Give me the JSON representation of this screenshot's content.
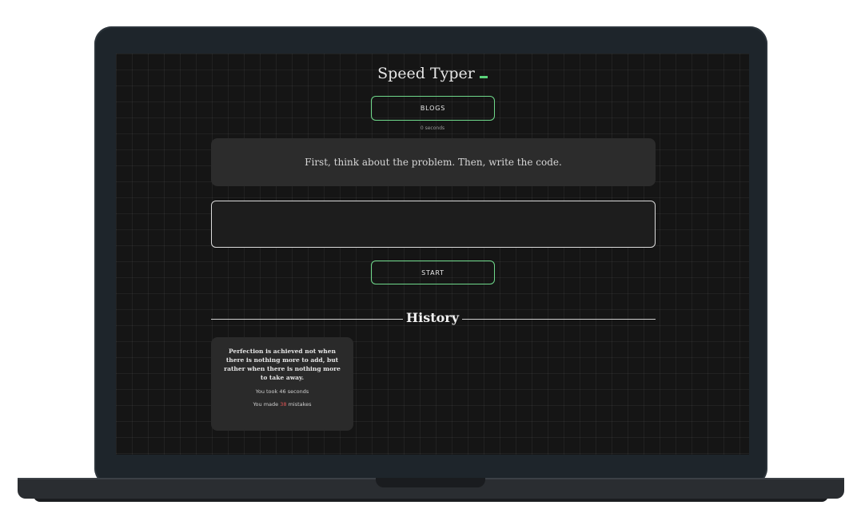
{
  "app": {
    "title": "Speed Typer"
  },
  "mode_button": {
    "label": "BLOGS"
  },
  "mode_sublabel": "0 seconds",
  "prompt_quote": "First, think about the problem. Then, write the code.",
  "typing_input": {
    "value": "",
    "placeholder": ""
  },
  "start_button": {
    "label": "START"
  },
  "history": {
    "title": "History",
    "entries": [
      {
        "quote": "Perfection is achieved not when there is nothing more to add, but rather when there is nothing more to take away.",
        "time_prefix": "You took ",
        "time_value": "46",
        "time_suffix": " seconds",
        "mistakes_prefix": "You made ",
        "mistakes_value": "38",
        "mistakes_suffix": " mistakes"
      }
    ]
  },
  "colors": {
    "accent": "#6fd98b",
    "cursor": "#5bd37b",
    "mistakes": "#e05555",
    "screen_bg": "#151515",
    "panel_bg": "#2c2c2c"
  }
}
